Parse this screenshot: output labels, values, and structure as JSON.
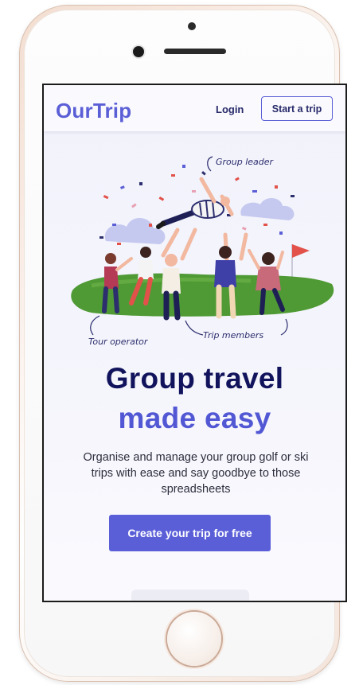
{
  "nav": {
    "logo": "OurTrip",
    "login_label": "Login",
    "start_label": "Start a trip"
  },
  "illustration": {
    "labels": {
      "group_leader": "Group leader",
      "tour_operator": "Tour operator",
      "trip_members": "Trip members"
    }
  },
  "hero": {
    "headline_line1": "Group travel",
    "headline_line2": "made easy",
    "subtext": "Organise and manage your group golf or ski trips with ease and say goodbye to those spreadsheets",
    "cta_label": "Create your trip for free"
  },
  "colors": {
    "brand": "#5b5fd6",
    "headline_dark": "#11145c",
    "cta_background": "#5a5fd8",
    "grass": "#4f9a35",
    "flag": "#e2524a"
  }
}
